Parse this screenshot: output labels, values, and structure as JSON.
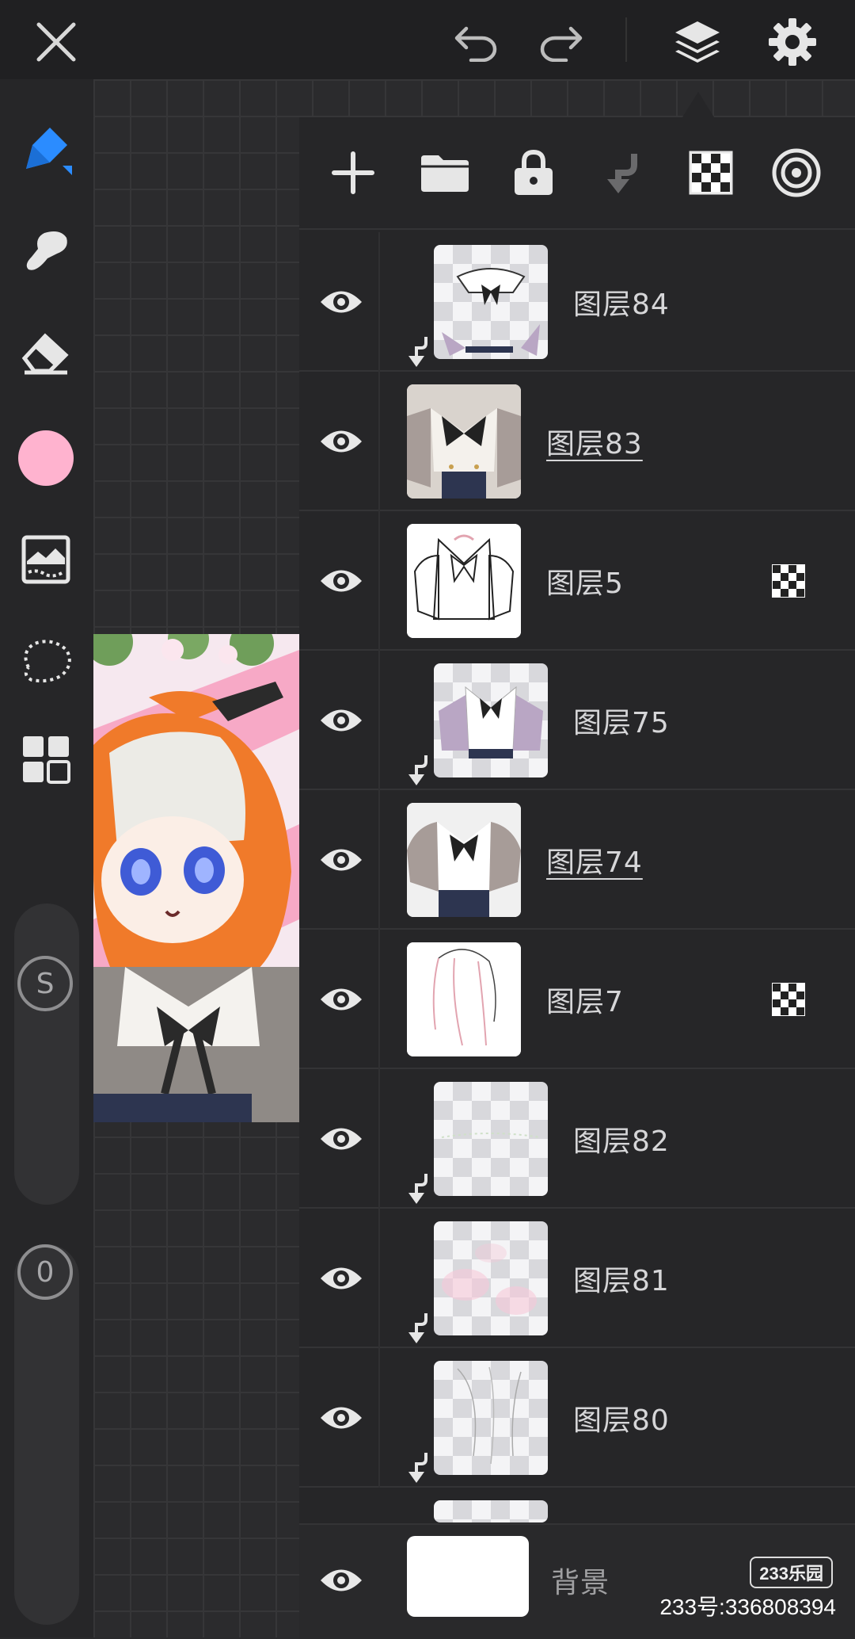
{
  "top_bar": {
    "icons": [
      "close-icon",
      "undo-icon",
      "redo-icon",
      "layers-icon",
      "settings-icon"
    ]
  },
  "left_toolbar": {
    "tools": [
      "pen-icon",
      "smudge-icon",
      "eraser-icon",
      "color-swatch",
      "filter-icon",
      "lasso-icon",
      "menu-grid-icon"
    ],
    "current_color": "#ffb3cf",
    "size_label": "S",
    "opacity_label": "0"
  },
  "layers_panel": {
    "toolbar_icons": [
      "add-layer-icon",
      "folder-icon",
      "lock-icon",
      "clip-down-icon",
      "alpha-lock-icon",
      "blend-mode-icon"
    ],
    "layers": [
      {
        "name": "图层84",
        "clipped": true,
        "alpha_locked": false,
        "underlined": false
      },
      {
        "name": "图层83",
        "clipped": false,
        "alpha_locked": false,
        "underlined": true
      },
      {
        "name": "图层5",
        "clipped": false,
        "alpha_locked": true,
        "underlined": false
      },
      {
        "name": "图层75",
        "clipped": true,
        "alpha_locked": false,
        "underlined": false
      },
      {
        "name": "图层74",
        "clipped": false,
        "alpha_locked": false,
        "underlined": true
      },
      {
        "name": "图层7",
        "clipped": false,
        "alpha_locked": true,
        "underlined": false
      },
      {
        "name": "图层82",
        "clipped": true,
        "alpha_locked": false,
        "underlined": false
      },
      {
        "name": "图层81",
        "clipped": true,
        "alpha_locked": false,
        "underlined": false
      },
      {
        "name": "图层80",
        "clipped": true,
        "alpha_locked": false,
        "underlined": false
      }
    ],
    "background_layer": {
      "name": "背景"
    }
  },
  "watermark": {
    "logo": "233乐园",
    "text": "233号:336808394"
  }
}
